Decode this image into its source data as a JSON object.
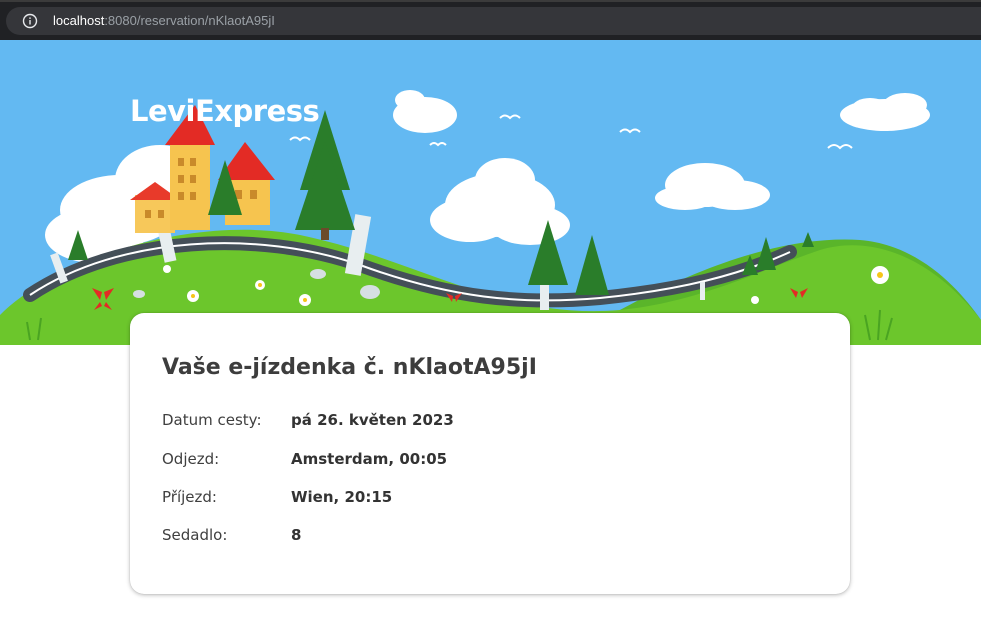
{
  "browser": {
    "url_host": "localhost",
    "url_path": ":8080/reservation/nKlaotA95jI",
    "info_icon": "info-icon"
  },
  "header": {
    "brand": "LeviExpress"
  },
  "ticket": {
    "title": "Vaše e-jízdenka č. nKlaotA95jI",
    "rows": [
      {
        "label": "Datum cesty:",
        "value": "pá 26. květen 2023"
      },
      {
        "label": "Odjezd:",
        "value": "Amsterdam, 00:05"
      },
      {
        "label": "Příjezd:",
        "value": "Wien, 20:15"
      },
      {
        "label": "Sedadlo:",
        "value": "8"
      }
    ]
  },
  "colors": {
    "sky": "#63b9f2",
    "grass": "#6cc62c",
    "road": "#444f58",
    "card_bg": "#ffffff",
    "browser_bg": "#202124"
  }
}
